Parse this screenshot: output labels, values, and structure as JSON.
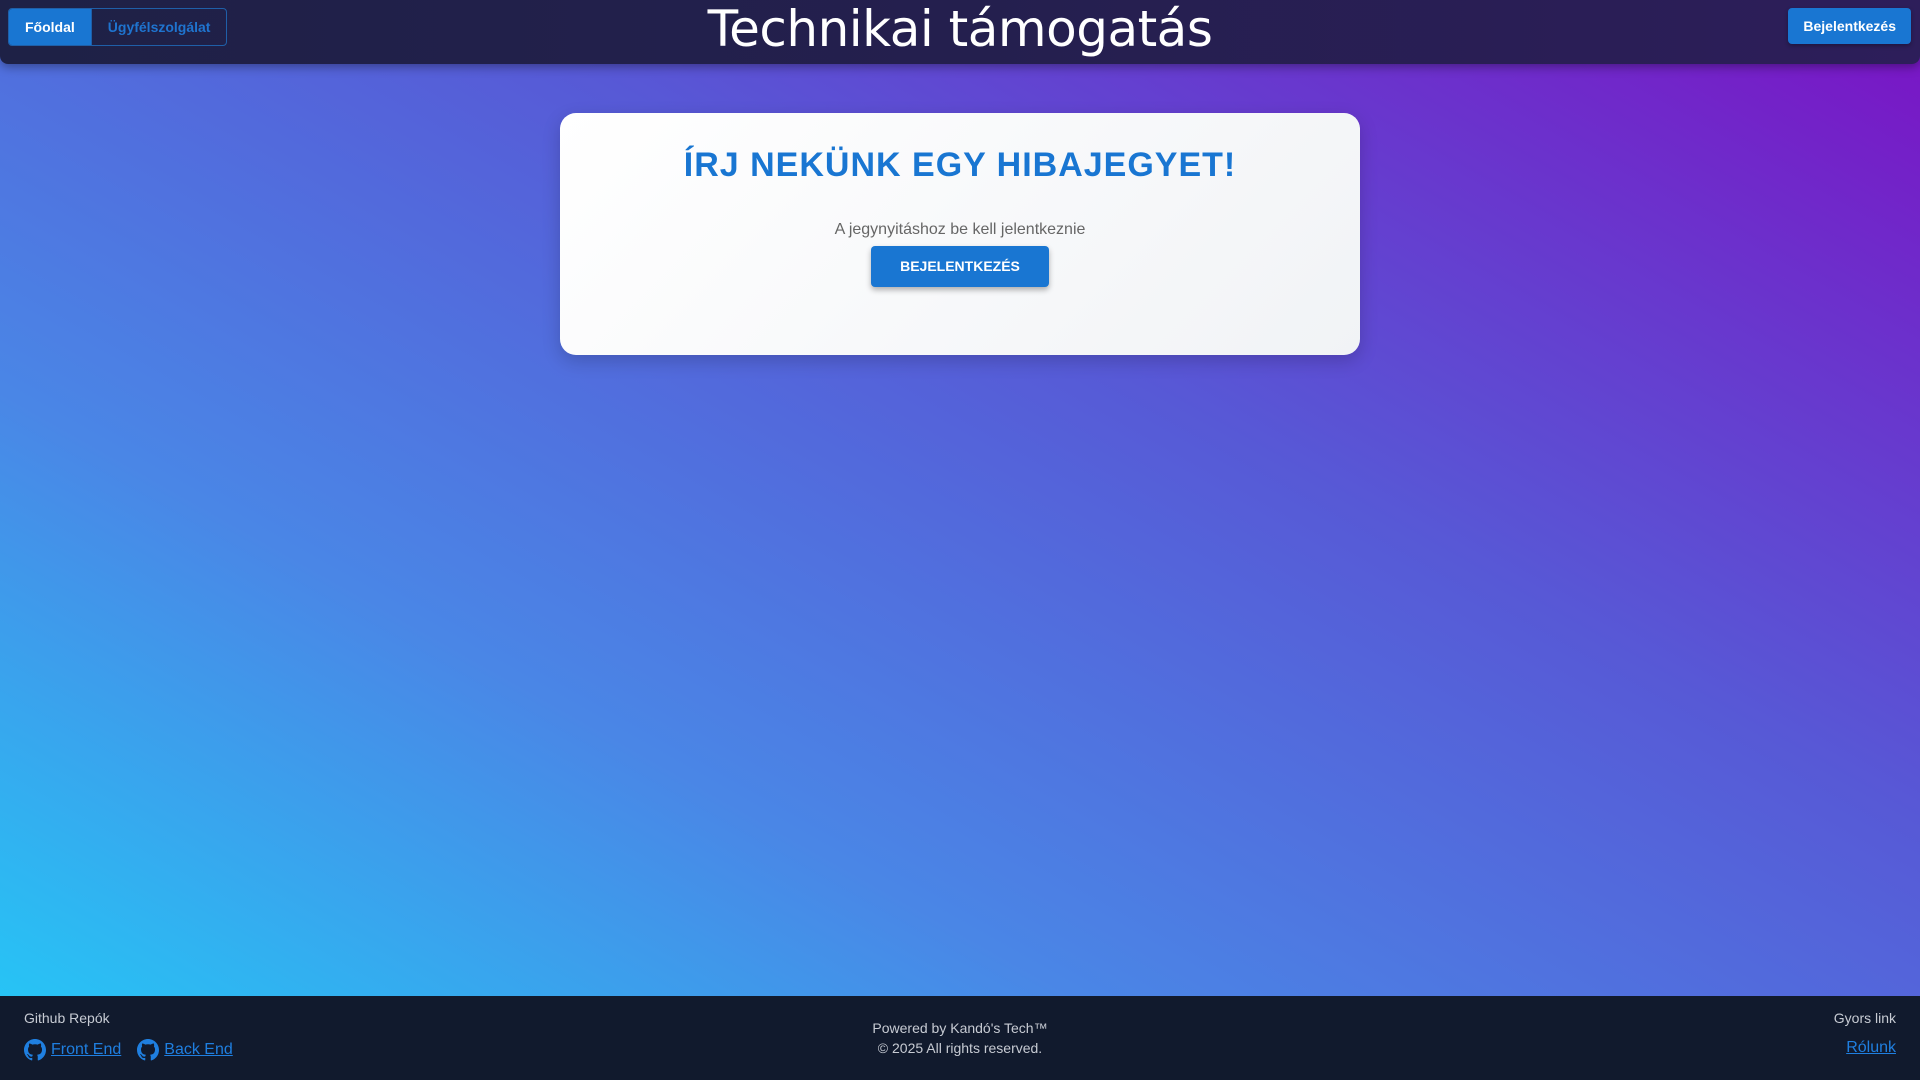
{
  "header": {
    "nav": [
      {
        "label": "Főoldal",
        "active": true
      },
      {
        "label": "Ügyfélszolgálat",
        "active": false
      }
    ],
    "title": "Technikai támogatás",
    "login_label": "Bejelentkezés"
  },
  "card": {
    "title": "ÍRJ NEKÜNK EGY HIBAJEGYET!",
    "subtitle": "A jegynyitáshoz be kell jelentkeznie",
    "login_label": "BEJELENTKEZÉS"
  },
  "footer": {
    "repos_heading": "Github Repók",
    "repos": [
      {
        "label": "Front End",
        "icon": "github-icon"
      },
      {
        "label": "Back End",
        "icon": "github-icon"
      }
    ],
    "powered": "Powered by Kandó's Tech™",
    "copyright": "© 2025 All rights reserved.",
    "quick_heading": "Gyors link",
    "quick_link": "Rólunk"
  },
  "colors": {
    "accent": "#1976d2",
    "link": "#1f7fe0",
    "footer_bg": "#111a2d",
    "header_bg": "#1e2146",
    "gradient_start": "#22ccf7",
    "gradient_end": "#7b12c4"
  }
}
